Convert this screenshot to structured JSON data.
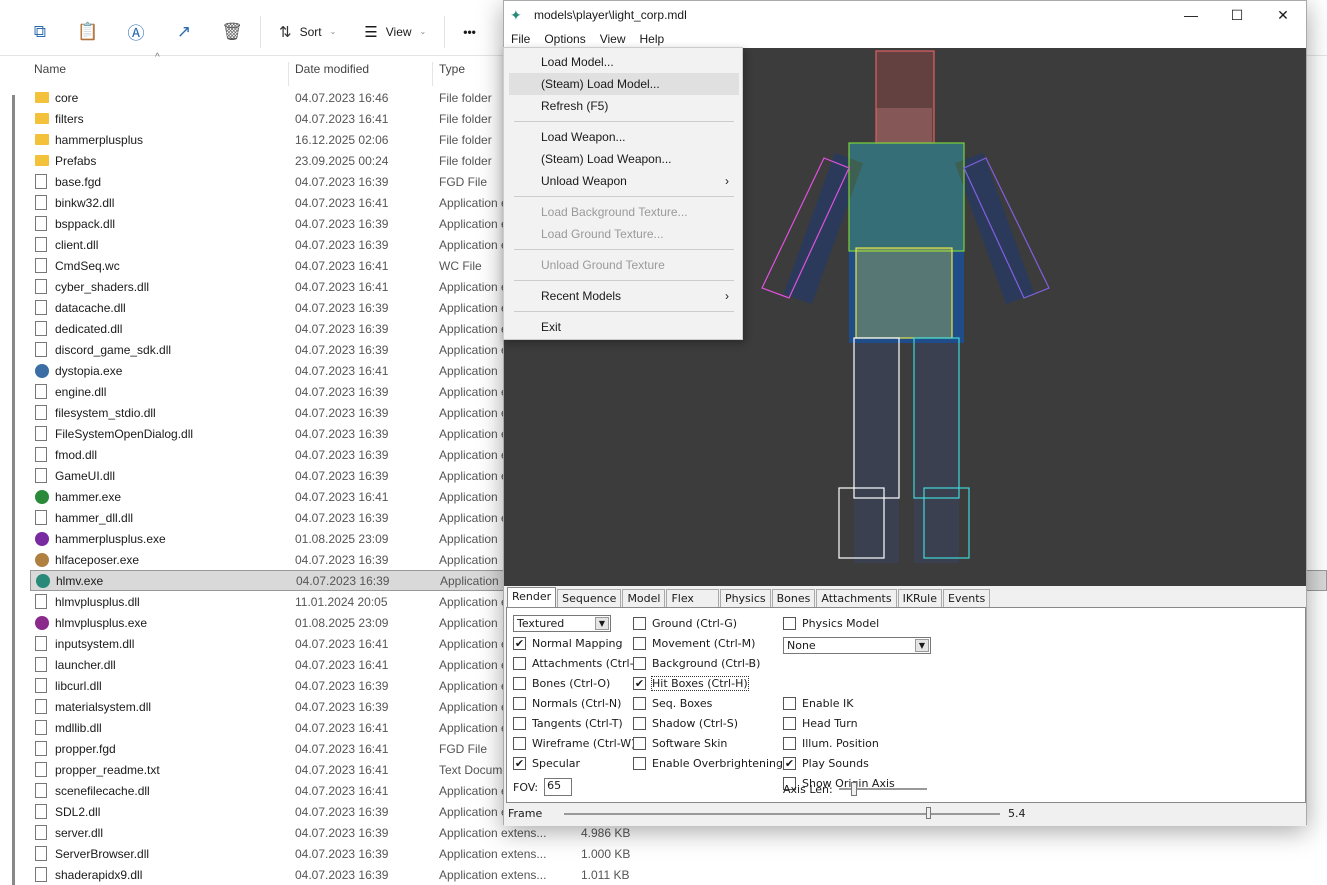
{
  "explorer": {
    "toolbar": {
      "sort_label": "Sort",
      "view_label": "View",
      "more_label": "•••"
    },
    "columns": {
      "name": "Name",
      "date": "Date modified",
      "type": "Type"
    },
    "files": [
      {
        "name": "core",
        "date": "04.07.2023 16:46",
        "type": "File folder",
        "icon": "folder"
      },
      {
        "name": "filters",
        "date": "04.07.2023 16:41",
        "type": "File folder",
        "icon": "folder"
      },
      {
        "name": "hammerplusplus",
        "date": "16.12.2025 02:06",
        "type": "File folder",
        "icon": "folder"
      },
      {
        "name": "Prefabs",
        "date": "23.09.2025 00:24",
        "type": "File folder",
        "icon": "folder"
      },
      {
        "name": "base.fgd",
        "date": "04.07.2023 16:39",
        "type": "FGD File",
        "icon": "file"
      },
      {
        "name": "binkw32.dll",
        "date": "04.07.2023 16:41",
        "type": "Application extens...",
        "icon": "file"
      },
      {
        "name": "bsppack.dll",
        "date": "04.07.2023 16:39",
        "type": "Application extens...",
        "icon": "file"
      },
      {
        "name": "client.dll",
        "date": "04.07.2023 16:39",
        "type": "Application extens...",
        "icon": "file"
      },
      {
        "name": "CmdSeq.wc",
        "date": "04.07.2023 16:41",
        "type": "WC File",
        "icon": "file"
      },
      {
        "name": "cyber_shaders.dll",
        "date": "04.07.2023 16:41",
        "type": "Application extens...",
        "icon": "file"
      },
      {
        "name": "datacache.dll",
        "date": "04.07.2023 16:39",
        "type": "Application extens...",
        "icon": "file"
      },
      {
        "name": "dedicated.dll",
        "date": "04.07.2023 16:39",
        "type": "Application extens...",
        "icon": "file"
      },
      {
        "name": "discord_game_sdk.dll",
        "date": "04.07.2023 16:39",
        "type": "Application extens...",
        "icon": "file"
      },
      {
        "name": "dystopia.exe",
        "date": "04.07.2023 16:41",
        "type": "Application",
        "icon": "exe-dystopia"
      },
      {
        "name": "engine.dll",
        "date": "04.07.2023 16:39",
        "type": "Application extens...",
        "icon": "file"
      },
      {
        "name": "filesystem_stdio.dll",
        "date": "04.07.2023 16:39",
        "type": "Application extens...",
        "icon": "file"
      },
      {
        "name": "FileSystemOpenDialog.dll",
        "date": "04.07.2023 16:39",
        "type": "Application extens...",
        "icon": "file"
      },
      {
        "name": "fmod.dll",
        "date": "04.07.2023 16:39",
        "type": "Application extens...",
        "icon": "file"
      },
      {
        "name": "GameUI.dll",
        "date": "04.07.2023 16:39",
        "type": "Application extens...",
        "icon": "file"
      },
      {
        "name": "hammer.exe",
        "date": "04.07.2023 16:41",
        "type": "Application",
        "icon": "exe-hammer"
      },
      {
        "name": "hammer_dll.dll",
        "date": "04.07.2023 16:39",
        "type": "Application extens...",
        "icon": "file"
      },
      {
        "name": "hammerplusplus.exe",
        "date": "01.08.2025 23:09",
        "type": "Application",
        "icon": "exe-hpp"
      },
      {
        "name": "hlfaceposer.exe",
        "date": "04.07.2023 16:39",
        "type": "Application",
        "icon": "exe-faceposer"
      },
      {
        "name": "hlmv.exe",
        "date": "04.07.2023 16:39",
        "type": "Application",
        "icon": "exe-hlmv",
        "selected": true
      },
      {
        "name": "hlmvplusplus.dll",
        "date": "11.01.2024 20:05",
        "type": "Application extens...",
        "icon": "file"
      },
      {
        "name": "hlmvplusplus.exe",
        "date": "01.08.2025 23:09",
        "type": "Application",
        "icon": "exe-hlmvpp"
      },
      {
        "name": "inputsystem.dll",
        "date": "04.07.2023 16:41",
        "type": "Application extens...",
        "icon": "file"
      },
      {
        "name": "launcher.dll",
        "date": "04.07.2023 16:41",
        "type": "Application extens...",
        "icon": "file"
      },
      {
        "name": "libcurl.dll",
        "date": "04.07.2023 16:39",
        "type": "Application extens...",
        "icon": "file"
      },
      {
        "name": "materialsystem.dll",
        "date": "04.07.2023 16:39",
        "type": "Application extens...",
        "icon": "file"
      },
      {
        "name": "mdllib.dll",
        "date": "04.07.2023 16:41",
        "type": "Application extens...",
        "icon": "file"
      },
      {
        "name": "propper.fgd",
        "date": "04.07.2023 16:41",
        "type": "FGD File",
        "icon": "file"
      },
      {
        "name": "propper_readme.txt",
        "date": "04.07.2023 16:41",
        "type": "Text Document",
        "icon": "file"
      },
      {
        "name": "scenefilecache.dll",
        "date": "04.07.2023 16:41",
        "type": "Application extens...",
        "icon": "file"
      },
      {
        "name": "SDL2.dll",
        "date": "04.07.2023 16:39",
        "type": "Application extens...",
        "icon": "file"
      },
      {
        "name": "server.dll",
        "date": "04.07.2023 16:39",
        "type": "Application extens...",
        "size": "4.986 KB",
        "icon": "file"
      },
      {
        "name": "ServerBrowser.dll",
        "date": "04.07.2023 16:39",
        "type": "Application extens...",
        "size": "1.000 KB",
        "icon": "file"
      },
      {
        "name": "shaderapidx9.dll",
        "date": "04.07.2023 16:39",
        "type": "Application extens...",
        "size": "1.011 KB",
        "icon": "file"
      }
    ]
  },
  "hlmv": {
    "title": "models\\player\\light_corp.mdl",
    "menu": [
      "File",
      "Options",
      "View",
      "Help"
    ],
    "file_menu": [
      {
        "label": "Load Model..."
      },
      {
        "label": "(Steam) Load Model...",
        "highlighted": true
      },
      {
        "label": "Refresh (F5)"
      },
      {
        "sep": true
      },
      {
        "label": "Load Weapon..."
      },
      {
        "label": "(Steam) Load Weapon..."
      },
      {
        "label": "Unload Weapon",
        "submenu": true
      },
      {
        "sep": true
      },
      {
        "label": "Load Background Texture...",
        "disabled": true
      },
      {
        "label": "Load Ground Texture...",
        "disabled": true
      },
      {
        "sep": true
      },
      {
        "label": "Unload Ground Texture",
        "disabled": true
      },
      {
        "sep": true
      },
      {
        "label": "Recent Models",
        "submenu": true
      },
      {
        "sep": true
      },
      {
        "label": "Exit"
      }
    ],
    "viewport_bg": "#3c3c3c",
    "tabs": [
      "Render",
      "Sequence",
      "Model",
      "Flex",
      "Physics",
      "Bones",
      "Attachments",
      "IKRule",
      "Events"
    ],
    "active_tab": "Render",
    "render_mode": "Textured",
    "physics_select": "None",
    "checkboxes": {
      "col1": [
        {
          "label": "Normal Mapping",
          "checked": true
        },
        {
          "label": "Attachments (Ctrl-A)",
          "checked": false
        },
        {
          "label": "Bones (Ctrl-O)",
          "checked": false
        },
        {
          "label": "Normals (Ctrl-N)",
          "checked": false
        },
        {
          "label": "Tangents (Ctrl-T)",
          "checked": false
        },
        {
          "label": "Wireframe (Ctrl-W)",
          "checked": false
        },
        {
          "label": "Specular",
          "checked": true
        }
      ],
      "col2": [
        {
          "label": "Ground (Ctrl-G)",
          "checked": false
        },
        {
          "label": "Movement (Ctrl-M)",
          "checked": false
        },
        {
          "label": "Background (Ctrl-B)",
          "checked": false
        },
        {
          "label": "Hit Boxes (Ctrl-H)",
          "checked": true
        },
        {
          "label": "Seq. Boxes",
          "checked": false
        },
        {
          "label": "Shadow (Ctrl-S)",
          "checked": false
        },
        {
          "label": "Software Skin",
          "checked": false
        },
        {
          "label": "Enable Overbrightening",
          "checked": false
        }
      ],
      "col3a": [
        {
          "label": "Physics Model",
          "checked": false
        }
      ],
      "col3b": [
        {
          "label": "Enable IK",
          "checked": false
        },
        {
          "label": "Head Turn",
          "checked": false
        },
        {
          "label": "Illum. Position",
          "checked": false
        },
        {
          "label": "Play Sounds",
          "checked": true
        },
        {
          "label": "Show Origin Axis",
          "checked": false
        }
      ]
    },
    "fov_label": "FOV:",
    "fov_value": "65",
    "axis_len_label": "Axis Len:",
    "axis_len_level": 0.15,
    "frame_label": "Frame",
    "frame_value": "5.4",
    "frame_level": 0.84
  }
}
